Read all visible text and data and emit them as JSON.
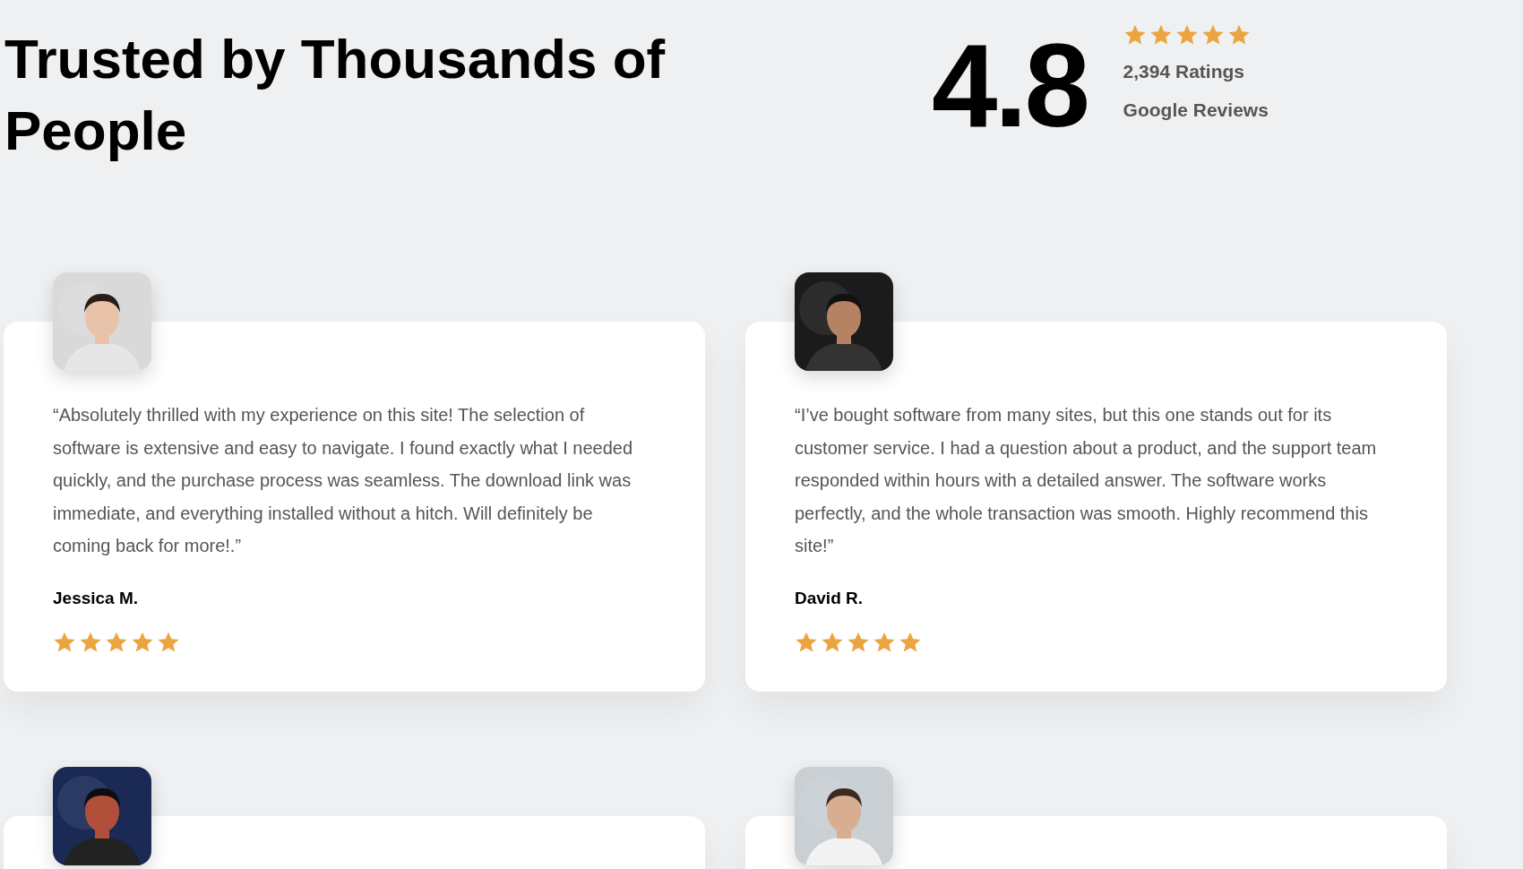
{
  "heading": "Trusted by Thousands of People",
  "rating": {
    "value": "4.8",
    "stars": 5,
    "count": "2,394 Ratings",
    "source": "Google Reviews"
  },
  "testimonials": [
    {
      "photo": {
        "kind": "picture"
      },
      "quote": "“Absolutely thrilled with my experience on this site! The selection of software is extensive and easy to navigate. I found exactly what I needed quickly, and the purchase process was seamless. The download link was immediate, and everything installed without a hitch. Will definitely be coming back for more!.”",
      "name": "Jessica M.",
      "stars": 5
    },
    {
      "photo": {
        "kind": "picture"
      },
      "quote": "“I’ve bought software from many sites, but this one stands out for its customer service. I had a question about a product, and the support team responded within hours with a detailed answer. The software works perfectly, and the whole transaction was smooth. Highly recommend this site!”",
      "name": "David R.",
      "stars": 5
    },
    {
      "photo": {
        "kind": "picture"
      }
    },
    {
      "photo": {
        "kind": "picture"
      }
    }
  ]
}
